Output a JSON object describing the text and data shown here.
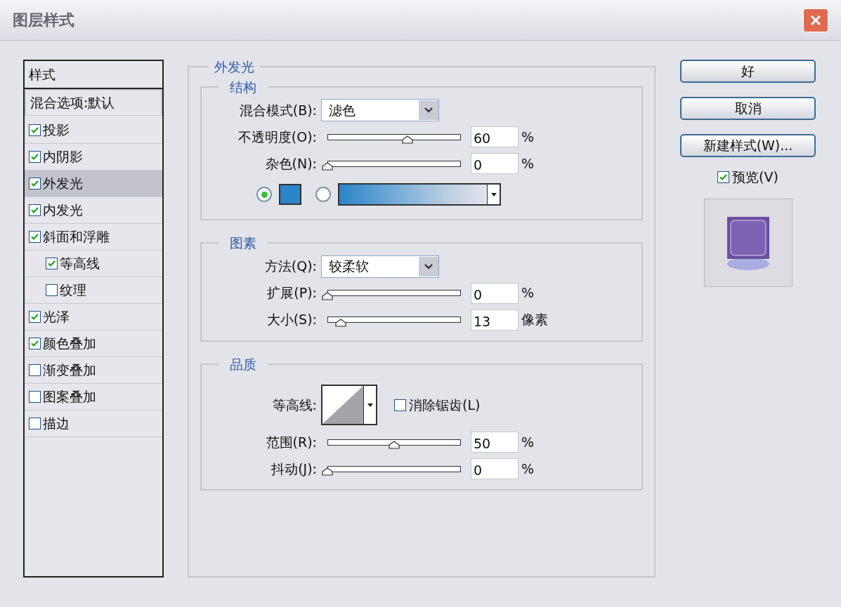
{
  "window": {
    "title": "图层样式"
  },
  "styles_list": {
    "header": "样式",
    "items": [
      {
        "label": "混合选项:默认",
        "kind": "plain",
        "selected": false
      },
      {
        "label": "投影",
        "kind": "check",
        "checked": true,
        "selected": false
      },
      {
        "label": "内阴影",
        "kind": "check",
        "checked": true,
        "selected": false
      },
      {
        "label": "外发光",
        "kind": "check",
        "checked": true,
        "selected": true
      },
      {
        "label": "内发光",
        "kind": "check",
        "checked": true,
        "selected": false
      },
      {
        "label": "斜面和浮雕",
        "kind": "check",
        "checked": true,
        "selected": false,
        "children": [
          {
            "label": "等高线",
            "kind": "check",
            "checked": true,
            "selected": false
          },
          {
            "label": "纹理",
            "kind": "check",
            "checked": false,
            "selected": false
          }
        ]
      },
      {
        "label": "光泽",
        "kind": "check",
        "checked": true,
        "selected": false
      },
      {
        "label": "颜色叠加",
        "kind": "check",
        "checked": true,
        "selected": false
      },
      {
        "label": "渐变叠加",
        "kind": "check",
        "checked": false,
        "selected": false
      },
      {
        "label": "图案叠加",
        "kind": "check",
        "checked": false,
        "selected": false
      },
      {
        "label": "描边",
        "kind": "check",
        "checked": false,
        "selected": false
      }
    ]
  },
  "panel": {
    "title": "外发光",
    "sections": [
      {
        "title": "结构",
        "rows": [
          {
            "kind": "select",
            "label": "混合模式(B):",
            "value": "滤色"
          },
          {
            "kind": "slider",
            "label": "不透明度(O):",
            "level": 0.6,
            "value": "60",
            "unit": "%"
          },
          {
            "kind": "slider",
            "label": "杂色(N):",
            "level": 0,
            "value": "0",
            "unit": "%"
          },
          {
            "kind": "fill",
            "options": [
              {
                "kind": "color",
                "selected": true
              },
              {
                "kind": "gradient",
                "selected": false
              }
            ]
          }
        ]
      },
      {
        "title": "图素",
        "rows": [
          {
            "kind": "select",
            "label": "方法(Q):",
            "value": "较柔软"
          },
          {
            "kind": "slider",
            "label": "扩展(P):",
            "level": 0,
            "value": "0",
            "unit": "%"
          },
          {
            "kind": "slider",
            "label": "大小(S):",
            "level": 0.1,
            "value": "13",
            "unit": "像素"
          }
        ]
      },
      {
        "title": "品质",
        "rows": [
          {
            "kind": "contour",
            "label": "等高线:",
            "checkbox": {
              "label": "消除锯齿(L)",
              "checked": false
            }
          },
          {
            "kind": "slider",
            "label": "范围(R):",
            "level": 0.5,
            "value": "50",
            "unit": "%"
          },
          {
            "kind": "slider",
            "label": "抖动(J):",
            "level": 0,
            "value": "0",
            "unit": "%"
          }
        ]
      }
    ]
  },
  "buttons": [
    "好",
    "取消",
    "新建样式(W)..."
  ],
  "preview": {
    "label": "预览(V)",
    "checked": true
  }
}
